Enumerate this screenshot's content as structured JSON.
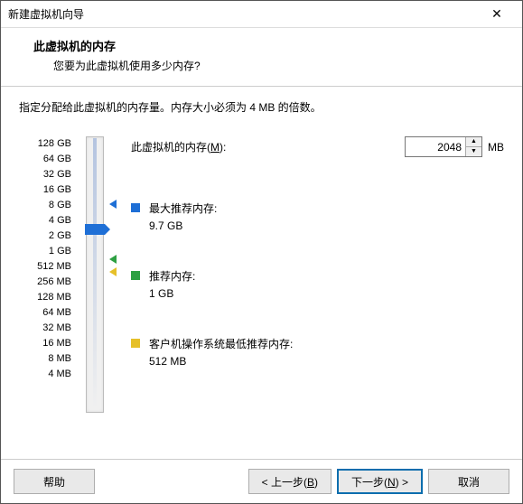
{
  "titlebar": {
    "title": "新建虚拟机向导"
  },
  "header": {
    "title": "此虚拟机的内存",
    "subtitle": "您要为此虚拟机使用多少内存?"
  },
  "desc": "指定分配给此虚拟机的内存量。内存大小必须为 4 MB 的倍数。",
  "memory": {
    "label_prefix": "此虚拟机的内存(",
    "label_key": "M",
    "label_suffix": "):",
    "value": "2048",
    "unit": "MB",
    "max": {
      "label": "最大推荐内存:",
      "value": "9.7 GB"
    },
    "rec": {
      "label": "推荐内存:",
      "value": "1 GB"
    },
    "min": {
      "label": "客户机操作系统最低推荐内存:",
      "value": "512 MB"
    }
  },
  "ticks": [
    "128 GB",
    "64 GB",
    "32 GB",
    "16 GB",
    "8 GB",
    "4 GB",
    "2 GB",
    "1 GB",
    "512 MB",
    "256 MB",
    "128 MB",
    "64 MB",
    "32 MB",
    "16 MB",
    "8 MB",
    "4 MB"
  ],
  "buttons": {
    "help": "帮助",
    "back_prefix": "< 上一步(",
    "back_key": "B",
    "back_suffix": ")",
    "next_prefix": "下一步(",
    "next_key": "N",
    "next_suffix": ") >",
    "cancel": "取消"
  }
}
